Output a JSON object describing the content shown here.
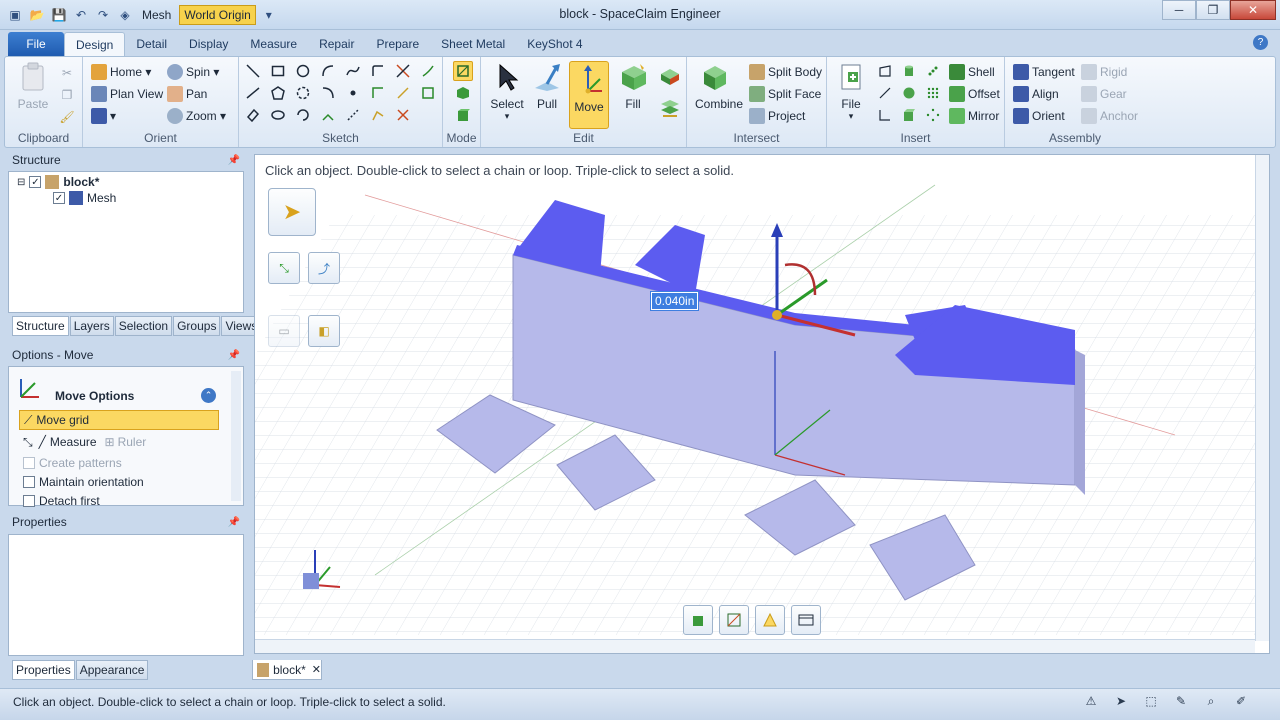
{
  "window": {
    "title": "block - SpaceClaim Engineer",
    "qat_mesh": "Mesh",
    "qat_world_origin": "World Origin"
  },
  "tabs": [
    "File",
    "Design",
    "Detail",
    "Display",
    "Measure",
    "Repair",
    "Prepare",
    "Sheet Metal",
    "KeyShot 4"
  ],
  "ribbon": {
    "clipboard": {
      "label": "Clipboard",
      "paste": "Paste"
    },
    "orient": {
      "label": "Orient",
      "home": "Home",
      "plan_view": "Plan View",
      "spin": "Spin",
      "pan": "Pan",
      "zoom": "Zoom"
    },
    "sketch": {
      "label": "Sketch"
    },
    "mode": {
      "label": "Mode"
    },
    "edit": {
      "label": "Edit",
      "select": "Select",
      "pull": "Pull",
      "move": "Move",
      "fill": "Fill"
    },
    "intersect": {
      "label": "Intersect",
      "combine": "Combine",
      "split_body": "Split Body",
      "split_face": "Split Face",
      "project": "Project"
    },
    "insert": {
      "label": "Insert",
      "file": "File",
      "shell": "Shell",
      "offset": "Offset",
      "mirror": "Mirror"
    },
    "assembly": {
      "label": "Assembly",
      "tangent": "Tangent",
      "align": "Align",
      "orient": "Orient",
      "rigid": "Rigid",
      "gear": "Gear",
      "anchor": "Anchor"
    }
  },
  "structure": {
    "title": "Structure",
    "root": "block*",
    "child": "Mesh",
    "tabs": [
      "Structure",
      "Layers",
      "Selection",
      "Groups",
      "Views"
    ]
  },
  "options": {
    "title": "Options - Move",
    "section": "Move Options",
    "move_grid": "Move grid",
    "measure": "Measure",
    "ruler": "Ruler",
    "create_patterns": "Create patterns",
    "maintain_orientation": "Maintain orientation",
    "detach_first": "Detach first"
  },
  "properties": {
    "title": "Properties",
    "tabs": [
      "Properties",
      "Appearance"
    ]
  },
  "viewport": {
    "hint": "Click an object.  Double-click to select a chain or loop.  Triple-click to select a solid.",
    "dimension": "0.040in"
  },
  "doc_tab": "block*",
  "status": "Click an object.  Double-click to select a chain or loop.  Triple-click to select a solid.",
  "colors": {
    "accent": "#fbd862",
    "model": "#b6b9ea",
    "model_highlight": "#5c5cf0"
  }
}
